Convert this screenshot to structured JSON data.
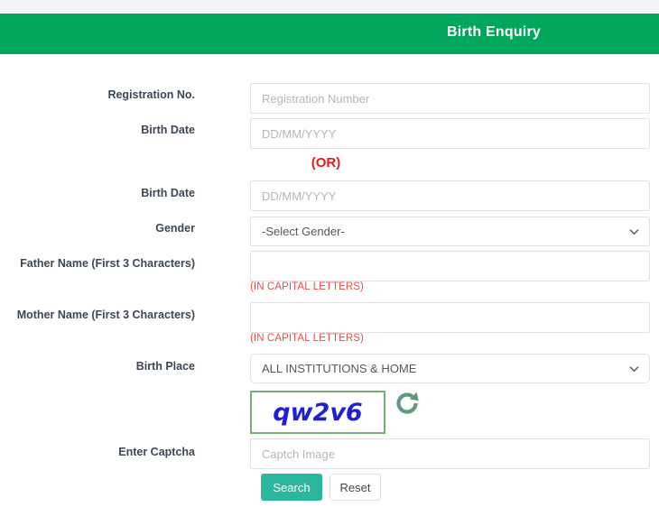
{
  "header": {
    "title": "Birth Enquiry",
    "bg_color": "#00a65a"
  },
  "form": {
    "fields": [
      {
        "label": "Registration No.",
        "placeholder": "Registration Number",
        "value": "",
        "type": "text"
      },
      {
        "label": "Birth Date",
        "placeholder": "DD/MM/YYYY",
        "value": "",
        "type": "text"
      },
      {
        "label": "Birth Date",
        "placeholder": "DD/MM/YYYY",
        "value": "",
        "type": "text"
      },
      {
        "label": "Gender",
        "selected": "-Select Gender-",
        "type": "select"
      },
      {
        "label": "Father Name (First 3 Characters)",
        "placeholder": "",
        "value": "",
        "type": "text",
        "caption": "(IN CAPITAL LETTERS)"
      },
      {
        "label": "Mother Name (First 3 Characters)",
        "placeholder": "",
        "value": "",
        "type": "text",
        "caption": "(IN CAPITAL LETTERS)"
      },
      {
        "label": "Birth Place",
        "selected": "ALL INSTITUTIONS & HOME",
        "type": "select"
      },
      {
        "label": "Enter Captcha",
        "placeholder": "Captch Image",
        "value": "",
        "type": "text"
      }
    ],
    "or_separator": "(OR)",
    "captcha": {
      "code": "qw2v6",
      "text_color": "#1f1fd8",
      "border_color": "#77ae77",
      "refresh_icon": "refresh-icon"
    },
    "buttons": {
      "search": "Search",
      "reset": "Reset",
      "search_color": "#2ab79b"
    }
  }
}
